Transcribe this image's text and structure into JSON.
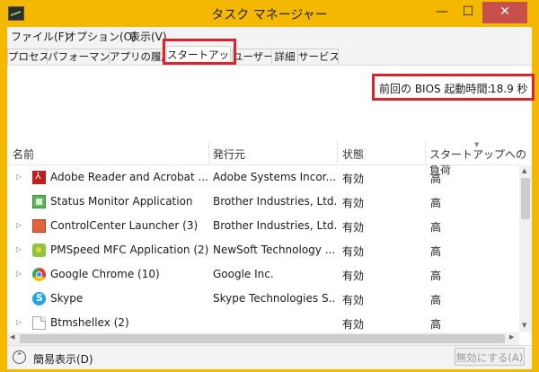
{
  "window": {
    "title": "タスク マネージャー",
    "controls": {
      "minimize": "—",
      "maximize": "☐",
      "close": "✕"
    }
  },
  "menu": [
    "ファイル(F)",
    "オプション(O)",
    "表示(V)"
  ],
  "tabs": [
    {
      "label": "プロセス",
      "active": false
    },
    {
      "label": "パフォーマンス",
      "active": false
    },
    {
      "label": "アプリの履歴",
      "active": false
    },
    {
      "label": "スタートアップ",
      "active": true
    },
    {
      "label": "ユーザー",
      "active": false
    },
    {
      "label": "詳細",
      "active": false
    },
    {
      "label": "サービス",
      "active": false
    }
  ],
  "bios": {
    "label": "前回の BIOS 起動時間:",
    "value": "18.9 秒"
  },
  "columns": {
    "name": "名前",
    "publisher": "発行元",
    "state": "状態",
    "impact": "スタートアップへの負荷"
  },
  "rows": [
    {
      "icon": "adobe-reader-icon",
      "expandable": true,
      "name": "Adobe Reader and Acrobat ...",
      "publisher": "Adobe Systems Incor...",
      "state": "有効",
      "impact": "高"
    },
    {
      "icon": "status-monitor-icon",
      "expandable": false,
      "name": "Status Monitor Application",
      "publisher": "Brother Industries, Ltd.",
      "state": "有効",
      "impact": "高"
    },
    {
      "icon": "control-center-icon",
      "expandable": true,
      "name": "ControlCenter Launcher (3)",
      "publisher": "Brother Industries, Ltd.",
      "state": "有効",
      "impact": "高"
    },
    {
      "icon": "pmspeed-icon",
      "expandable": true,
      "name": "PMSpeed MFC Application (2)",
      "publisher": "NewSoft Technology ...",
      "state": "有効",
      "impact": "高"
    },
    {
      "icon": "chrome-icon",
      "expandable": true,
      "name": "Google Chrome (10)",
      "publisher": "Google Inc.",
      "state": "有効",
      "impact": "高"
    },
    {
      "icon": "skype-icon",
      "expandable": false,
      "name": "Skype",
      "publisher": "Skype Technologies S...",
      "state": "有効",
      "impact": "高"
    },
    {
      "icon": "file-icon",
      "expandable": true,
      "name": "Btmshellex (2)",
      "publisher": "",
      "state": "有効",
      "impact": "高"
    }
  ],
  "footer": {
    "fewer_details": "簡易表示(D)",
    "disable_button": "無効にする(A)"
  },
  "colors": {
    "title_bar": "#f5b800",
    "highlight_border": "#d8242f",
    "close_button": "#c7504a"
  }
}
